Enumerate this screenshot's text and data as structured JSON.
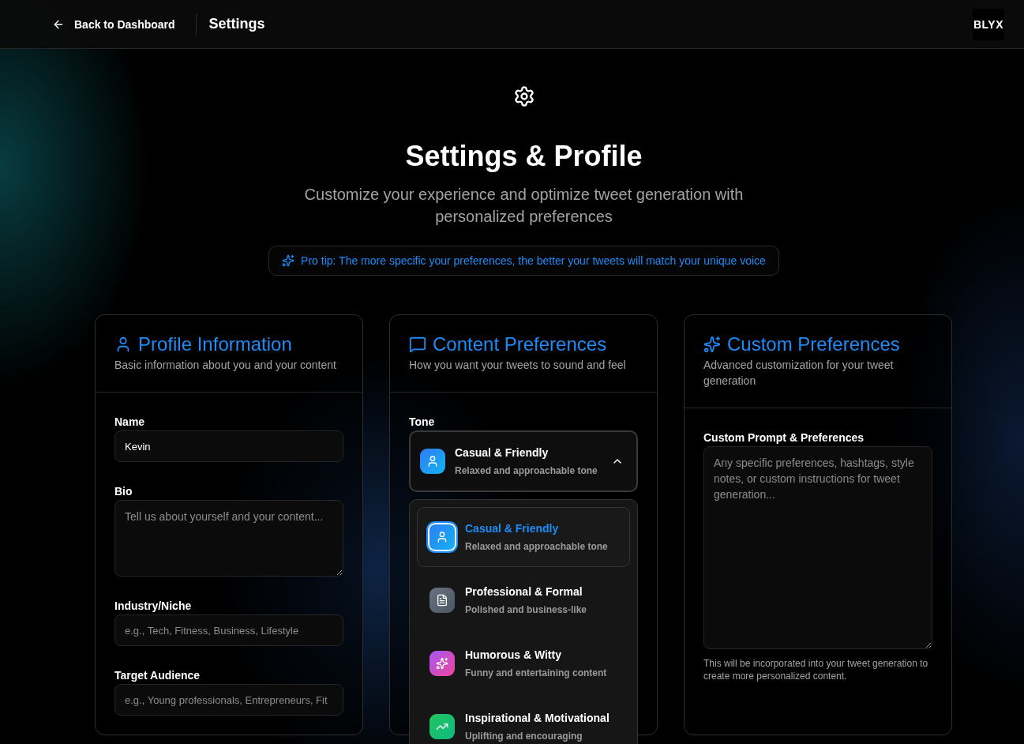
{
  "header": {
    "back_link": "Back to Dashboard",
    "title": "Settings",
    "logo": "BLYX"
  },
  "hero": {
    "title": "Settings & Profile",
    "subtitle": "Customize your experience and optimize tweet generation with personalized preferences",
    "tip": "Pro tip: The more specific your preferences, the better your tweets will match your unique voice"
  },
  "cards": [
    {
      "kind": "profile",
      "title": "Profile Information",
      "description": "Basic information about you and your content",
      "fields": [
        {
          "kind": "input",
          "label": "Name",
          "value": "Kevin"
        },
        {
          "kind": "textarea",
          "label": "Bio",
          "placeholder": "Tell us about yourself and your content..."
        },
        {
          "kind": "input",
          "label": "Industry/Niche",
          "placeholder": "e.g., Tech, Fitness, Business, Lifestyle"
        },
        {
          "kind": "input",
          "label": "Target Audience",
          "placeholder": "e.g., Young professionals, Entrepreneurs, Fit"
        }
      ]
    },
    {
      "kind": "content",
      "title": "Content Preferences",
      "description": "How you want your tweets to sound and feel",
      "fields": [
        {
          "kind": "select",
          "label": "Tone",
          "value": {
            "title": "Casual & Friendly",
            "description": "Relaxed and approachable tone"
          },
          "expanded": true,
          "options": [
            {
              "title": "Casual & Friendly",
              "description": "Relaxed and approachable tone",
              "selected": true
            },
            {
              "title": "Professional & Formal",
              "description": "Polished and business-like",
              "selected": false
            },
            {
              "title": "Humorous & Witty",
              "description": "Funny and entertaining content",
              "selected": false
            },
            {
              "title": "Inspirational & Motivational",
              "description": "Uplifting and encouraging",
              "selected": false
            }
          ]
        }
      ]
    },
    {
      "kind": "custom",
      "title": "Custom Preferences",
      "description": "Advanced customization for your tweet generation",
      "fields": [
        {
          "kind": "textarea",
          "label": "Custom Prompt & Preferences",
          "placeholder": "Any specific preferences, hashtags, style notes, or custom instructions for tweet generation...",
          "help": "This will be incorporated into your tweet generation to create more personalized content."
        }
      ]
    }
  ]
}
